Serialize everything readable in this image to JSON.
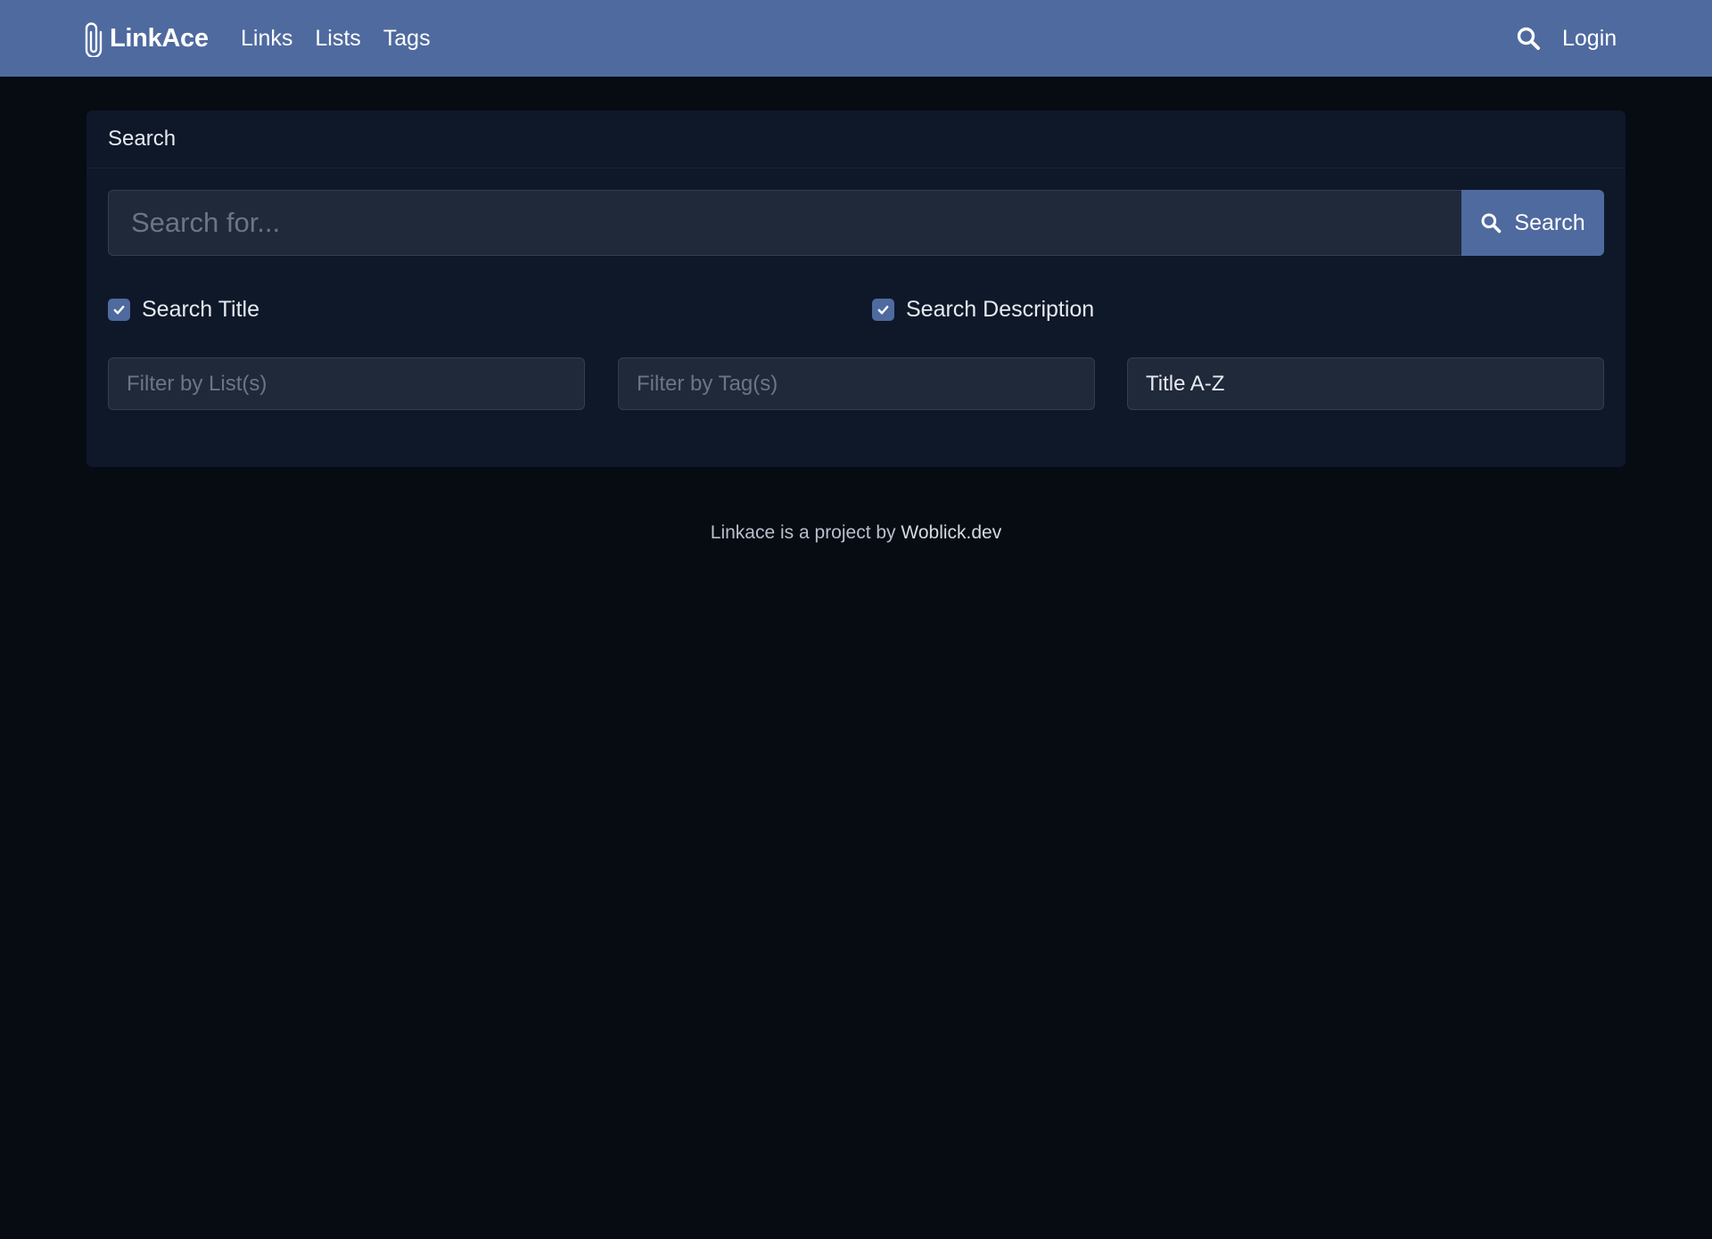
{
  "navbar": {
    "brand": "LinkAce",
    "links": [
      {
        "label": "Links"
      },
      {
        "label": "Lists"
      },
      {
        "label": "Tags"
      }
    ],
    "login": "Login",
    "icons": {
      "brand": "paperclip-icon",
      "search": "search-icon"
    }
  },
  "search_card": {
    "header": "Search",
    "query": {
      "placeholder": "Search for...",
      "value": ""
    },
    "button_label": "Search",
    "options": [
      {
        "label": "Search Title",
        "checked": true
      },
      {
        "label": "Search Description",
        "checked": true
      }
    ],
    "filters": {
      "lists_placeholder": "Filter by List(s)",
      "tags_placeholder": "Filter by Tag(s)",
      "order_by": "Title A-Z"
    }
  },
  "footer": {
    "text": "Linkace is a project by ",
    "link": "Woblick.dev"
  },
  "colors": {
    "navbar": "#4f6a9f",
    "background": "#070b12",
    "card": "#0f1829",
    "input": "#1f293a",
    "accent": "#4f6a9f"
  }
}
